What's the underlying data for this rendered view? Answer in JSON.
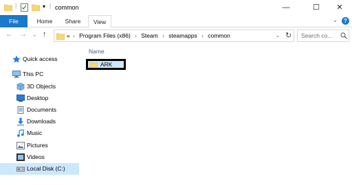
{
  "window": {
    "title": "common",
    "minimize": "—",
    "maximize": "☐",
    "close": "✕"
  },
  "ribbon": {
    "tabs": [
      {
        "label": "File"
      },
      {
        "label": "Home"
      },
      {
        "label": "Share"
      },
      {
        "label": "View"
      }
    ],
    "expand": "⌄",
    "help": "?"
  },
  "navigation": {
    "back": "←",
    "forward": "→",
    "recent": "⌄",
    "up": "↑"
  },
  "address": {
    "overflow": "«",
    "crumbs": [
      "Program Files (x86)",
      "Steam",
      "steamapps",
      "common"
    ],
    "separator": "›",
    "dropdown": "⌄",
    "refresh": "↻"
  },
  "search": {
    "placeholder": "Search co..."
  },
  "sidebar": {
    "items": [
      {
        "label": "Quick access",
        "icon": "star-icon"
      },
      {
        "label": "This PC",
        "icon": "computer-icon"
      },
      {
        "label": "3D Objects",
        "icon": "cube-icon"
      },
      {
        "label": "Desktop",
        "icon": "desktop-icon"
      },
      {
        "label": "Documents",
        "icon": "documents-icon"
      },
      {
        "label": "Downloads",
        "icon": "download-icon"
      },
      {
        "label": "Music",
        "icon": "music-icon"
      },
      {
        "label": "Pictures",
        "icon": "pictures-icon"
      },
      {
        "label": "Videos",
        "icon": "videos-icon"
      },
      {
        "label": "Local Disk (C:)",
        "icon": "disk-icon"
      }
    ]
  },
  "content": {
    "column_header": "Name",
    "files": [
      {
        "name": "ARK",
        "type": "folder"
      }
    ]
  },
  "colors": {
    "accent": "#1979ca",
    "selection": "#cce8ff",
    "folder": "#f8d775"
  }
}
